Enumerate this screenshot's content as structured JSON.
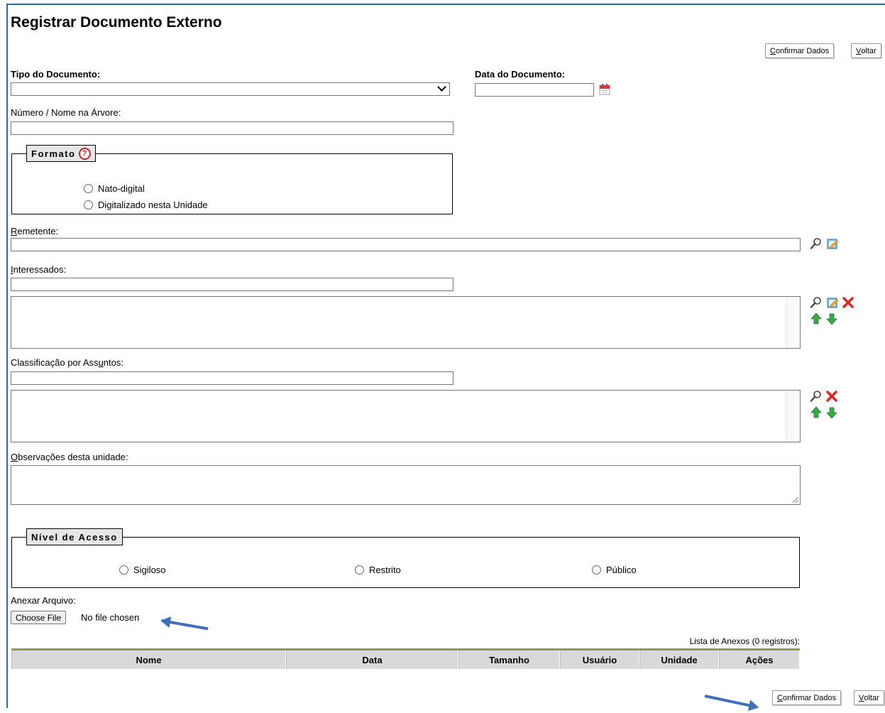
{
  "page_title": "Registrar Documento Externo",
  "toolbar": {
    "confirm_label_rest": "onfirmar Dados",
    "confirm_label_first": "C",
    "back_label_first": "V",
    "back_label_rest": "oltar"
  },
  "fields": {
    "tipo_documento_label": "Tipo do Documento:",
    "data_documento_label": "Data do Documento:",
    "numero_nome_label": "Número / Nome na Árvore:",
    "remetente_label_first": "R",
    "remetente_label_rest": "emetente:",
    "interessados_label_first": "I",
    "interessados_label_rest": "nteressados:",
    "classificacao_label_pre": "Classificação por Ass",
    "classificacao_label_u": "u",
    "classificacao_label_post": "ntos:",
    "observacoes_label_first": "O",
    "observacoes_label_rest": "bservações desta unidade:",
    "anexar_label": "Anexar Arquivo:"
  },
  "formato": {
    "legend": "Formato",
    "help_glyph": "?",
    "options": [
      "Nato-digital",
      "Digitalizado nesta Unidade"
    ]
  },
  "nivel_acesso": {
    "legend": "Nível de Acesso",
    "options": [
      "Sigiloso",
      "Restrito",
      "Público"
    ]
  },
  "file_input": {
    "button_label": "Choose File",
    "status": "No file chosen"
  },
  "anexos": {
    "caption": "Lista de Anexos (0 registros):",
    "columns": [
      "Nome",
      "Data",
      "Tamanho",
      "Usuário",
      "Unidade",
      "Ações"
    ]
  },
  "icons": {
    "search": "magnifier-icon",
    "edit": "edit-icon",
    "remove": "remove-icon",
    "up": "arrow-up-icon",
    "down": "arrow-down-icon",
    "calendar": "calendar-icon"
  },
  "colors": {
    "frame_border": "#2a6db5",
    "annotation_arrow": "#3f6fb8",
    "table_header_bg": "#d9d9d9",
    "table_header_border": "#8f9a54",
    "remove_red": "#e02424",
    "arrow_green": "#3aa648"
  }
}
